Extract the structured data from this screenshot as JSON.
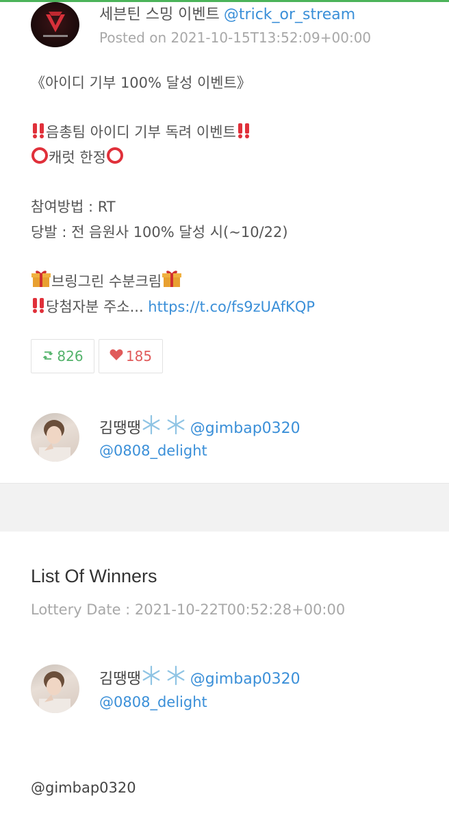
{
  "post": {
    "author_name": "세븐틴 스밍 이벤트",
    "author_handle": "@trick_or_stream",
    "posted_on": "Posted on 2021-10-15T13:52:09+00:00",
    "lines": {
      "l1": "《아이디 기부 100% 달성 이벤트》",
      "l2": "음총팀 아이디 기부 독려 이벤트",
      "l3": "캐럿 한정",
      "l4": "참여방법 : RT",
      "l5": "당발 : 전 음원사 100% 달성 시(~10/22)",
      "l6": "브링그린 수분크림",
      "l7_text": "당첨자분 주소... ",
      "l7_link": "https://t.co/fs9zUAfKQP"
    },
    "retweets": "826",
    "likes": "185"
  },
  "participant": {
    "name": "김땡땡",
    "handle": "@gimbap0320",
    "handle2": "@0808_delight"
  },
  "winners": {
    "title": "List Of Winners",
    "lottery_date": "Lottery Date : 2021-10-22T00:52:28+00:00",
    "winner": {
      "name": "김땡땡",
      "handle": "@gimbap0320",
      "handle2": "@0808_delight"
    },
    "footer_handle": "@gimbap0320"
  },
  "colors": {
    "accent_link": "#3a8fd8",
    "retweet": "#52b26a",
    "like": "#e05a5a",
    "top_bar": "#4cb35a"
  },
  "icons": [
    "retweet-icon",
    "heart-icon",
    "snowflake-icon",
    "double-exclamation-icon",
    "circle-icon",
    "gift-icon"
  ]
}
